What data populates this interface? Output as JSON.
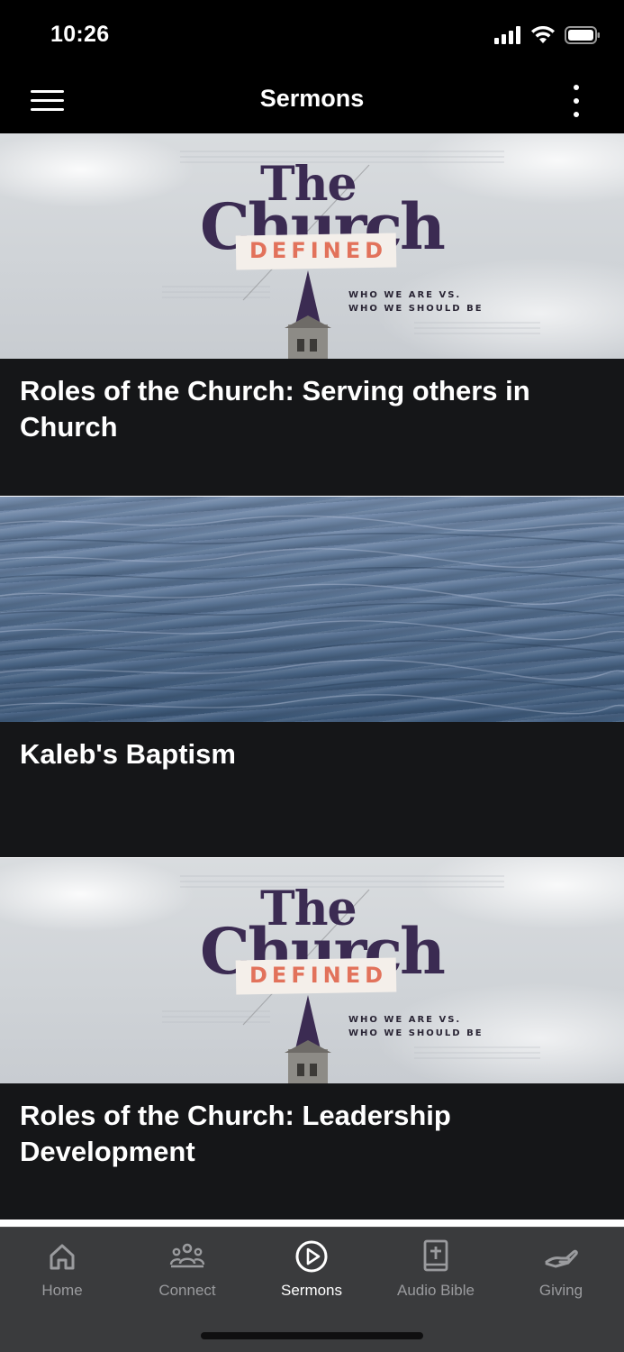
{
  "status_bar": {
    "time": "10:26"
  },
  "nav": {
    "title": "Sermons"
  },
  "sermons": [
    {
      "title": "Roles of the Church: Serving others in Church",
      "artwork": {
        "kind": "series-graphic",
        "line1": "The",
        "line2": "Church",
        "line3": "DEFINED",
        "sub1": "WHO WE ARE VS.",
        "sub2": "WHO WE SHOULD BE"
      }
    },
    {
      "title": "Kaleb's Baptism",
      "artwork": {
        "kind": "water-photo"
      }
    },
    {
      "title": "Roles of the Church: Leadership Development",
      "artwork": {
        "kind": "series-graphic",
        "line1": "The",
        "line2": "Church",
        "line3": "DEFINED",
        "sub1": "WHO WE ARE VS.",
        "sub2": "WHO WE SHOULD BE"
      }
    }
  ],
  "tabs": [
    {
      "label": "Home",
      "icon": "home-icon",
      "active": false
    },
    {
      "label": "Connect",
      "icon": "people-icon",
      "active": false
    },
    {
      "label": "Sermons",
      "icon": "play-circle-icon",
      "active": true
    },
    {
      "label": "Audio Bible",
      "icon": "bible-icon",
      "active": false
    },
    {
      "label": "Giving",
      "icon": "giving-hand-icon",
      "active": false
    }
  ],
  "colors": {
    "background": "#000000",
    "card_background": "#151618",
    "tab_bar": "#3a3b3d",
    "tab_inactive": "#9a9b9e",
    "tab_active": "#ffffff",
    "series_purple": "#3b2b52",
    "series_coral": "#e2725b"
  }
}
